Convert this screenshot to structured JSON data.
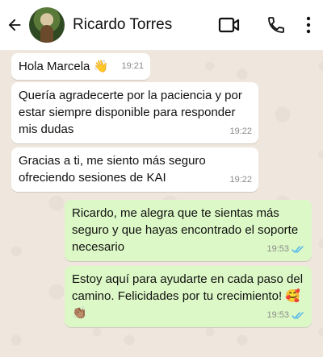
{
  "header": {
    "contact_name": "Ricardo Torres"
  },
  "messages": [
    {
      "text": "Hola Marcela 👋",
      "time": "19:21",
      "direction": "in"
    },
    {
      "text": "Quería agradecerte por la paciencia y por estar siempre disponible para responder mis dudas",
      "time": "19:22",
      "direction": "in"
    },
    {
      "text": "Gracias a ti, me siento más seguro ofreciendo sesiones de KAI",
      "time": "19:22",
      "direction": "in"
    },
    {
      "text": "Ricardo, me alegra que te sientas más seguro y que hayas encontrado el soporte necesario",
      "time": "19:53",
      "direction": "out",
      "read": true
    },
    {
      "text": "Estoy aquí para ayudarte en cada paso del camino. Felicidades por tu crecimiento! 🥰👏🏽",
      "time": "19:53",
      "direction": "out",
      "read": true
    }
  ],
  "colors": {
    "incoming_bubble": "#ffffff",
    "outgoing_bubble": "#dcf8c6",
    "read_ticks": "#4fb6ec",
    "chat_background": "#efe7de"
  },
  "icons": [
    "back-arrow-icon",
    "video-call-icon",
    "voice-call-icon",
    "more-options-icon",
    "double-check-icon"
  ]
}
